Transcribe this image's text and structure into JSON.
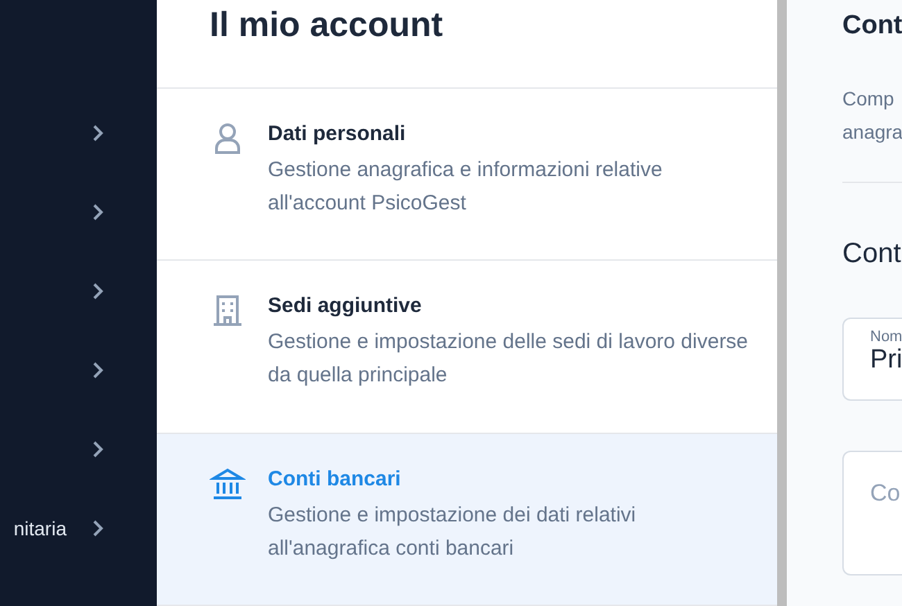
{
  "sidebar": {
    "items": [
      {
        "expanded": false
      },
      {
        "expanded": false
      },
      {
        "expanded": false
      },
      {
        "expanded": false
      },
      {
        "expanded": false
      },
      {
        "label": "nitaria",
        "expanded": false
      }
    ]
  },
  "account": {
    "title": "Il mio account",
    "items": [
      {
        "kind": "person",
        "title": "Dati personali",
        "description": "Gestione anagrafica e informazioni relative all'account PsicoGest",
        "selected": false
      },
      {
        "kind": "building",
        "title": "Sedi aggiuntive",
        "description": "Gestione e impostazione delle sedi di lavoro diverse da quella principale",
        "selected": false
      },
      {
        "kind": "bank",
        "title": "Conti bancari",
        "description": "Gestione e impostazione dei dati relativi all'anagrafica conti bancari",
        "selected": true
      }
    ]
  },
  "detail": {
    "title": "Cont",
    "description_lines": [
      "Comp",
      "anagra"
    ],
    "section_title": "Cont",
    "fields": [
      {
        "label": "Nom",
        "value": "Pri"
      },
      {
        "placeholder": "Co"
      }
    ]
  }
}
